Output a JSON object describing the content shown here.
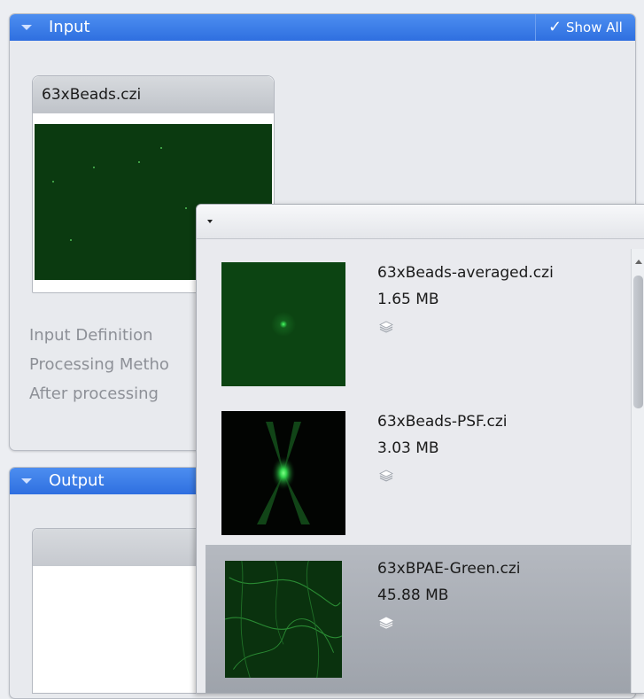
{
  "input_panel": {
    "title": "Input",
    "show_all_label": "Show All",
    "thumbnail": {
      "file_name": "63xBeads.czi"
    },
    "settings": [
      "Input Definition",
      "Processing Metho",
      "After processing"
    ]
  },
  "output_panel": {
    "title": "Output"
  },
  "file_picker": {
    "items": [
      {
        "name": "63xBeads-averaged.czi",
        "size": "1.65 MB",
        "icon": "layers-icon"
      },
      {
        "name": "63xBeads-PSF.czi",
        "size": "3.03 MB",
        "icon": "layers-icon"
      },
      {
        "name": "63xBPAE-Green.czi",
        "size": "45.88 MB",
        "icon": "layers-icon",
        "selected": true
      }
    ]
  },
  "colors": {
    "header_blue": "#2f6fe0",
    "accent_green": "#2fd14a"
  }
}
